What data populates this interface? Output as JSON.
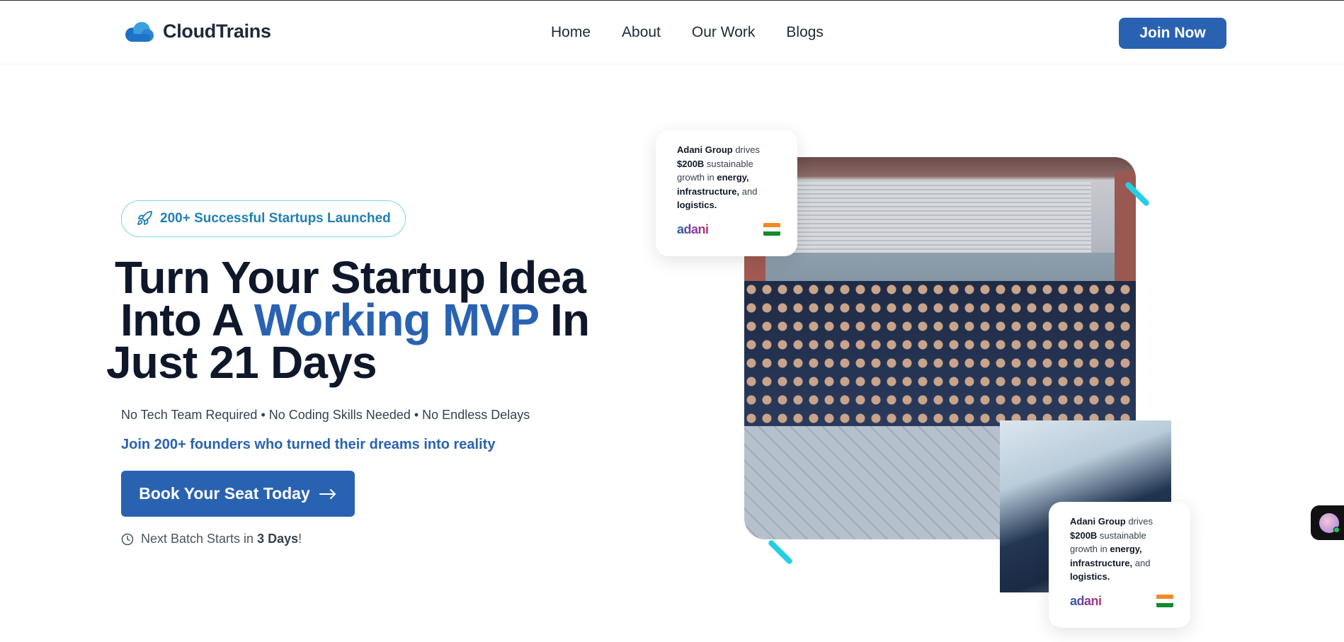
{
  "header": {
    "brand": "CloudTrains",
    "nav": [
      {
        "label": "Home"
      },
      {
        "label": "About"
      },
      {
        "label": "Our Work"
      },
      {
        "label": "Blogs"
      }
    ],
    "join_label": "Join Now"
  },
  "hero": {
    "badge": "200+ Successful Startups Launched",
    "headline": {
      "line1": "Turn Your Startup Idea",
      "line2_prefix": "Into A ",
      "line2_accent": "Working MVP",
      "line2_suffix": " In",
      "line3": "Just 21 Days"
    },
    "subtext": "No Tech Team Required • No Coding Skills Needed • No Endless Delays",
    "join_line": "Join 200+ founders who turned their dreams into reality",
    "cta_label": "Book Your Seat Today",
    "batch": {
      "prefix": "Next Batch Starts in ",
      "days": "3 Days",
      "suffix": "!"
    }
  },
  "cards": [
    {
      "company": "Adani Group",
      "t1": " drives ",
      "amount": "$200B",
      "t2": " sustainable growth in ",
      "k1": "energy,",
      "t3": " ",
      "k2": "infrastructure,",
      "t4": " and ",
      "k3": "logistics.",
      "logo": "adani"
    },
    {
      "company": "Adani Group",
      "t1": " drives ",
      "amount": "$200B",
      "t2": " sustainable growth in ",
      "k1": "energy,",
      "t3": " ",
      "k2": "infrastructure,",
      "t4": " and ",
      "k3": "logistics.",
      "logo": "adani"
    }
  ],
  "colors": {
    "primary": "#2a62b2",
    "accent_cyan": "#22cfe4",
    "badge_text": "#1f7fb6",
    "heading": "#0f172a"
  },
  "icons": {
    "brand": "cloud-icon",
    "badge": "rocket-icon",
    "cta": "arrow-right-icon",
    "batch": "clock-icon",
    "card_flag": "india-flag-icon"
  }
}
